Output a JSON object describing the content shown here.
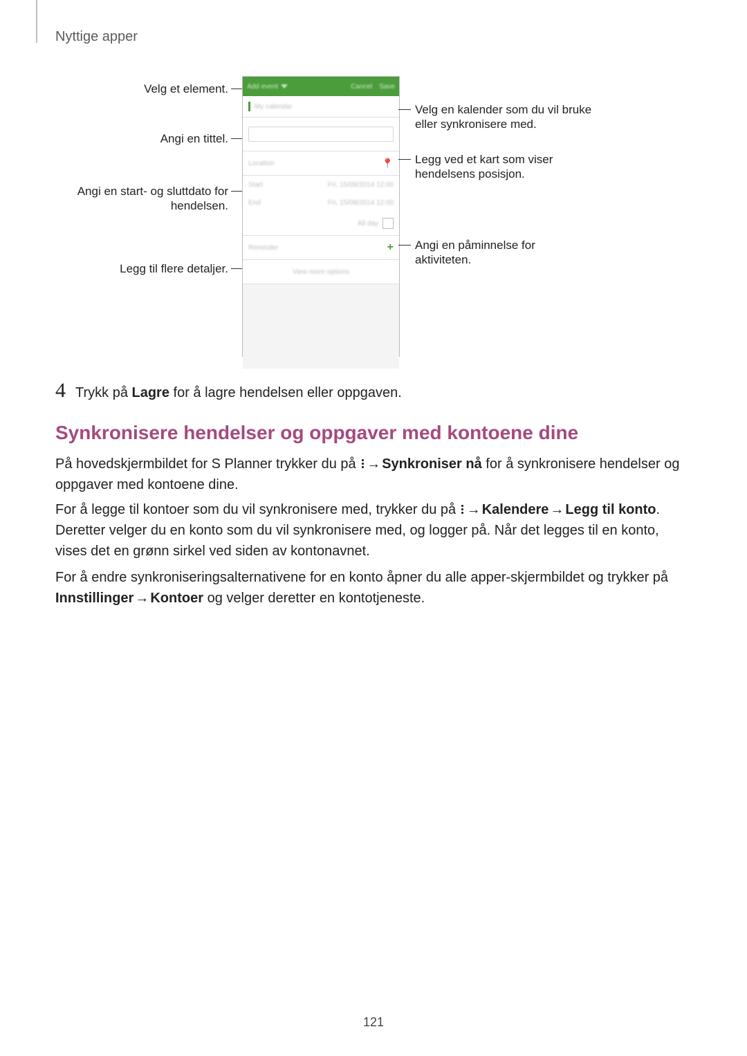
{
  "header": {
    "breadcrumb": "Nyttige apper"
  },
  "figure": {
    "callouts": {
      "left1": "Velg et element.",
      "left2": "Angi en tittel.",
      "left3a": "Angi en start- og sluttdato for",
      "left3b": "hendelsen.",
      "left4": "Legg til flere detaljer.",
      "right1a": "Velg en kalender som du vil bruke",
      "right1b": "eller synkronisere med.",
      "right2a": "Legg ved et kart som viser",
      "right2b": "hendelsens posisjon.",
      "right3a": "Angi en påminnelse for",
      "right3b": "aktiviteten."
    },
    "phone": {
      "header_label": "Add event",
      "cancel": "Cancel",
      "save": "Save",
      "calendar": "My calendar",
      "location": "Location",
      "start": "Start",
      "end": "End",
      "date": "Fri, 15/08/2014   12:00",
      "allday": "All day",
      "reminder": "Reminder",
      "more": "View more options"
    }
  },
  "step4": {
    "num": "4",
    "text_before": "Trykk på ",
    "bold": "Lagre",
    "text_after": " for å lagre hendelsen eller oppgaven."
  },
  "section": {
    "title": "Synkronisere hendelser og oppgaver med kontoene dine"
  },
  "p1": {
    "a": "På hovedskjermbildet for S Planner trykker du på ",
    "b": " → ",
    "c": "Synkroniser nå",
    "d": " for å synkronisere hendelser og oppgaver med kontoene dine."
  },
  "p2": {
    "a": "For å legge til kontoer som du vil synkronisere med, trykker du på ",
    "b": " → ",
    "c": "Kalendere",
    "d": " → ",
    "e": "Legg til konto",
    "f": ". Deretter velger du en konto som du vil synkronisere med, og logger på. Når det legges til en konto, vises det en grønn sirkel ved siden av kontonavnet."
  },
  "p3": {
    "a": "For å endre synkroniseringsalternativene for en konto åpner du alle apper-skjermbildet og trykker på ",
    "b": "Innstillinger",
    "c": " → ",
    "d": "Kontoer",
    "e": " og velger deretter en kontotjeneste."
  },
  "page_number": "121"
}
